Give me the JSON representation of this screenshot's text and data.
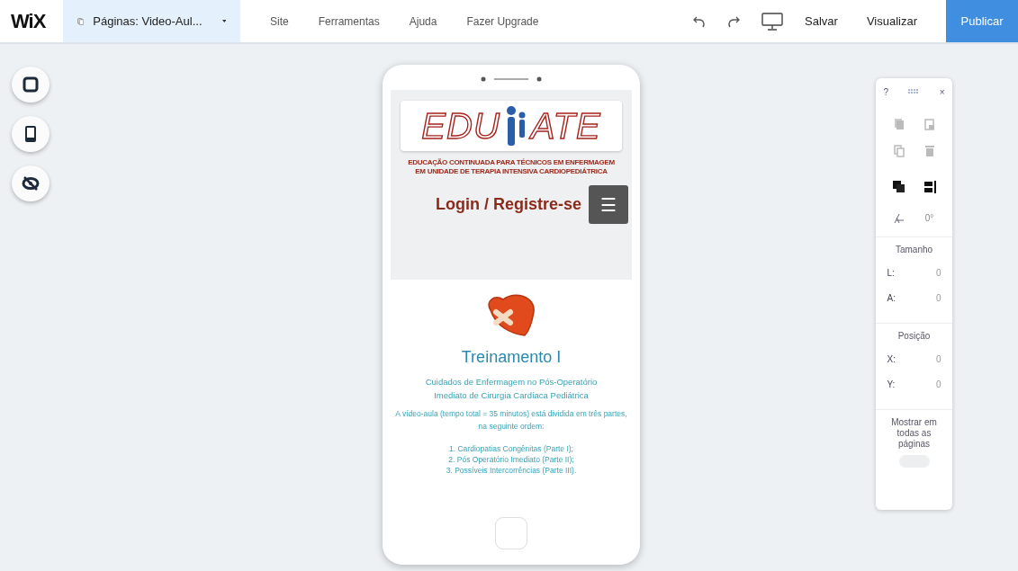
{
  "topbar": {
    "logo": "WiX",
    "pages": "Páginas: Video-Aul...",
    "menu": [
      "Site",
      "Ferramentas",
      "Ajuda",
      "Fazer Upgrade"
    ],
    "save": "Salvar",
    "preview": "Visualizar",
    "publish": "Publicar"
  },
  "phone": {
    "logo_left": "EDU",
    "logo_right": "ATE",
    "tagline": [
      "EDUCAÇÃO CONTINUADA PARA TÉCNICOS EM ENFERMAGEM",
      "EM UNIDADE DE TERAPIA INTENSIVA CARDIOPEDIÁTRICA"
    ],
    "login": "Login / Registre-se",
    "menu_glyph": "☰",
    "card": {
      "title": "Treinamento I",
      "subtitle": [
        "Cuidados de Enfermagem no Pós-Operatório",
        "Imediato de Cirurgia Cardíaca Pediátrica"
      ],
      "intro": "A vídeo-aula (tempo total = 35 minutos) está dividida em três partes, na seguinte ordem:",
      "parts": [
        "1. Cardiopatias Congênitas (Parte I);",
        "2. Pós Operatório Imediato (Parte II);",
        "3. Possíveis Intercorrências (Parte III)."
      ]
    }
  },
  "panel": {
    "help": "?",
    "close": "×",
    "rotation": "0°",
    "size_title": "Tamanho",
    "size_fields": [
      {
        "label": "L:",
        "value": "0"
      },
      {
        "label": "A:",
        "value": "0"
      }
    ],
    "position_title": "Posição",
    "position_fields": [
      {
        "label": "X:",
        "value": "0"
      },
      {
        "label": "Y:",
        "value": "0"
      }
    ],
    "show_all": "Mostrar em todas as páginas",
    "toggle": {
      "on": false
    }
  }
}
